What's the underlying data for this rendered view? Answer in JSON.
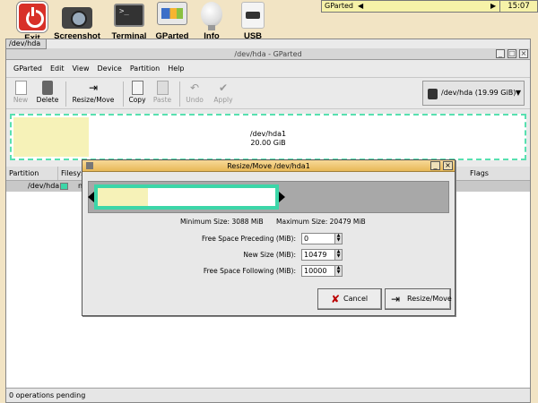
{
  "desktop": {
    "icons": [
      {
        "label": "Exit",
        "icon": "power-icon"
      },
      {
        "label": "Screenshot",
        "icon": "camera-icon"
      },
      {
        "label": "Terminal",
        "icon": "terminal-icon"
      },
      {
        "label": "GParted",
        "icon": "gparted-icon"
      },
      {
        "label": "Info",
        "icon": "lightbulb-icon"
      },
      {
        "label": "USB",
        "icon": "usb-icon"
      }
    ]
  },
  "taskbar": {
    "active_task": "GParted",
    "clock": "15:07",
    "prev_arrow": "◀",
    "next_arrow": "▶"
  },
  "window": {
    "tab_label": "/dev/hda",
    "title": "/dev/hda - GParted",
    "menu": [
      "GParted",
      "Edit",
      "View",
      "Device",
      "Partition",
      "Help"
    ],
    "toolbar": {
      "new": "New",
      "delete": "Delete",
      "resize_move": "Resize/Move",
      "copy": "Copy",
      "paste": "Paste",
      "undo": "Undo",
      "apply": "Apply"
    },
    "device": {
      "label": "/dev/hda",
      "size": "(19.99 GiB)"
    },
    "disk_map": {
      "partition": "/dev/hda1",
      "size": "20.00 GiB"
    },
    "table": {
      "columns": [
        "Partition",
        "Filesys",
        "Flags"
      ],
      "rows": [
        {
          "partition": "/dev/hda1",
          "fs_short": "n"
        }
      ]
    },
    "status": "0 operations pending"
  },
  "dialog": {
    "title": "Resize/Move /dev/hda1",
    "min_size": "Minimum Size: 3088 MiB",
    "max_size": "Maximum Size: 20479 MiB",
    "fields": {
      "free_preceding_label": "Free Space Preceding (MiB):",
      "free_preceding_value": "0",
      "new_size_label": "New Size (MiB):",
      "new_size_value": "10479",
      "free_following_label": "Free Space Following (MiB):",
      "free_following_value": "10000"
    },
    "cancel": "Cancel",
    "resize_move": "Resize/Move"
  },
  "colors": {
    "partition_accent": "#3cd6a8",
    "used_space": "#f6f2b8",
    "dialog_title": "#e8b857"
  }
}
